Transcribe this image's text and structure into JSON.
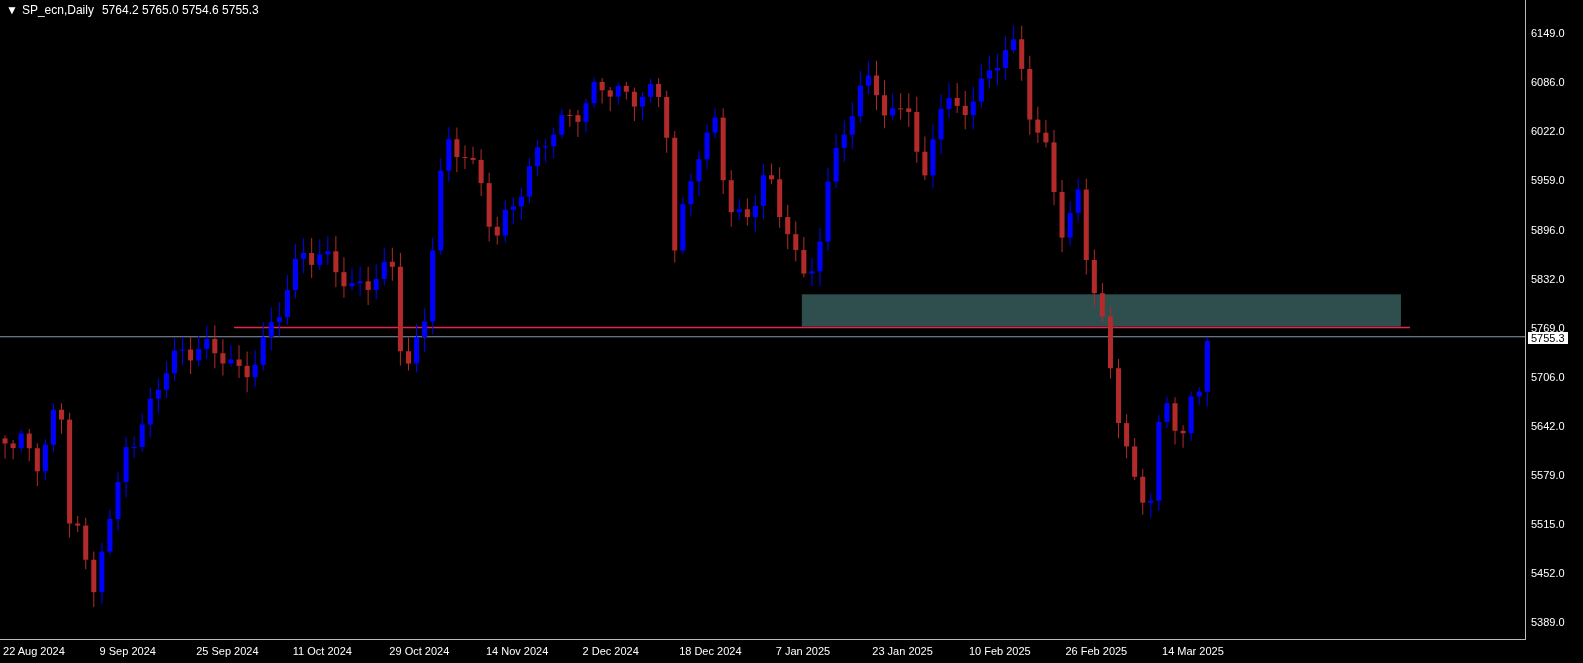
{
  "header": {
    "marker": "▼",
    "symbol": "SP_ecn,Daily",
    "ohlc": "5764.2 5765.0 5754.6 5755.3"
  },
  "price_axis": [
    "6149.0",
    "6086.0",
    "6022.0",
    "5959.0",
    "5896.0",
    "5832.0",
    "5769.0",
    "5706.0",
    "5642.0",
    "5579.0",
    "5515.0",
    "5452.0",
    "5389.0"
  ],
  "current_price": "5755.3",
  "time_axis": [
    "22 Aug 2024",
    "9 Sep 2024",
    "25 Sep 2024",
    "11 Oct 2024",
    "29 Oct 2024",
    "14 Nov 2024",
    "2 Dec 2024",
    "18 Dec 2024",
    "7 Jan 2025",
    "23 Jan 2025",
    "10 Feb 2025",
    "26 Feb 2025",
    "14 Mar 2025"
  ]
}
